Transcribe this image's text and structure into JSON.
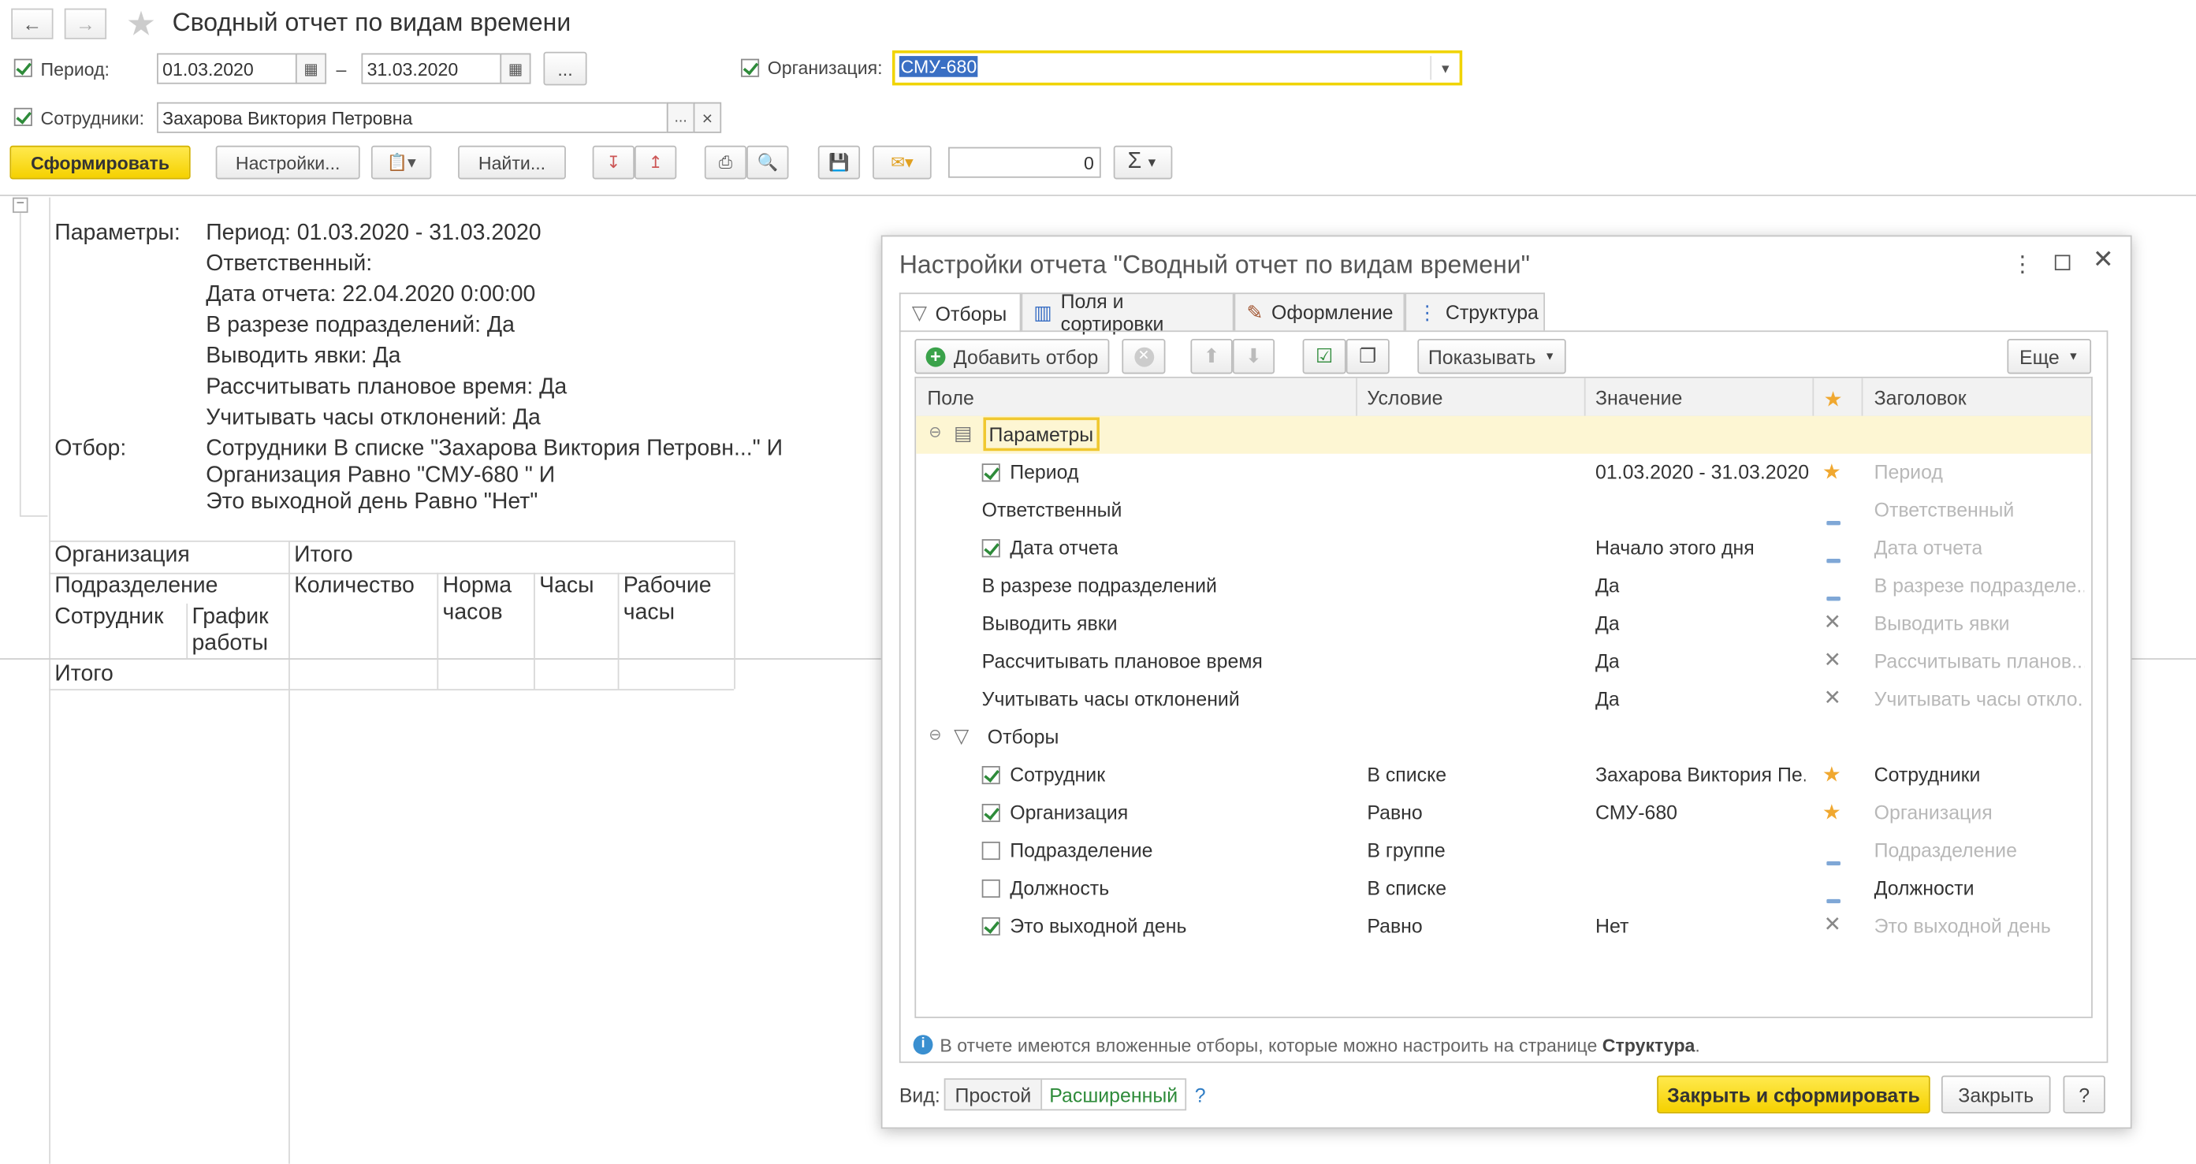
{
  "window": {
    "title": "Сводный отчет по видам времени"
  },
  "form": {
    "period_label": "Период:",
    "period_from": "01.03.2020",
    "period_dash": "–",
    "period_to": "31.03.2020",
    "ellipsis": "...",
    "org_label": "Организация:",
    "org_value": "СМУ-680",
    "employees_label": "Сотрудники:",
    "employees_value": "Захарова Виктория Петровна",
    "clear": "×"
  },
  "toolbar": {
    "generate": "Сформировать",
    "settings": "Настройки...",
    "find": "Найти...",
    "sum_value": "0",
    "sigma": "Σ"
  },
  "report": {
    "params_label": "Параметры:",
    "params": [
      "Период: 01.03.2020 - 31.03.2020",
      "Ответственный:",
      "Дата отчета: 22.04.2020 0:00:00",
      "В разрезе подразделений: Да",
      "Выводить явки: Да",
      "Рассчитывать плановое время: Да",
      "Учитывать часы отклонений: Да"
    ],
    "filter_label": "Отбор:",
    "filters": [
      "Сотрудники В списке \"Захарова Виктория Петровн...\" И",
      "Организация Равно \"СМУ-680 \" И",
      "Это выходной день Равно \"Нет\""
    ],
    "table": {
      "org": "Организация",
      "total_head": "Итого",
      "dept": "Подразделение",
      "qty": "Количество",
      "norm1": "Норма",
      "norm2": "часов",
      "hours": "Часы",
      "work1": "Рабочие",
      "work2": "часы",
      "emp": "Сотрудник",
      "sched1": "График",
      "sched2": "работы",
      "total_row": "Итого"
    }
  },
  "dialog": {
    "title": "Настройки отчета \"Сводный отчет по видам времени\"",
    "tabs": [
      "Отборы",
      "Поля и сортировки",
      "Оформление",
      "Структура"
    ],
    "add_filter": "Добавить отбор",
    "show": "Показывать",
    "more": "Еще",
    "columns": [
      "Поле",
      "Условие",
      "Значение",
      "Заголовок"
    ],
    "groups": {
      "params": "Параметры",
      "filters": "Отборы"
    },
    "param_rows": [
      {
        "field": "Период",
        "value": "01.03.2020 - 31.03.2020",
        "title": "Период"
      },
      {
        "field": "Ответственный",
        "value": "",
        "title": "Ответственный"
      },
      {
        "field": "Дата отчета",
        "value": "Начало этого дня",
        "title": "Дата отчета"
      },
      {
        "field": "В разрезе подразделений",
        "value": "Да",
        "title": "В разрезе подразделе..."
      },
      {
        "field": "Выводить явки",
        "value": "Да",
        "title": "Выводить явки"
      },
      {
        "field": "Рассчитывать плановое время",
        "value": "Да",
        "title": "Рассчитывать планов..."
      },
      {
        "field": "Учитывать часы отклонений",
        "value": "Да",
        "title": "Учитывать часы откло..."
      }
    ],
    "filter_rows": [
      {
        "field": "Сотрудник",
        "cond": "В списке",
        "value": "Захарова Виктория Пе...",
        "title": "Сотрудники"
      },
      {
        "field": "Организация",
        "cond": "Равно",
        "value": "СМУ-680",
        "title": "Организация"
      },
      {
        "field": "Подразделение",
        "cond": "В группе",
        "value": "",
        "title": "Подразделение"
      },
      {
        "field": "Должность",
        "cond": "В списке",
        "value": "",
        "title": "Должности"
      },
      {
        "field": "Это выходной день",
        "cond": "Равно",
        "value": "Нет",
        "title": "Это выходной день"
      }
    ],
    "info_text": "В отчете имеются вложенные отборы, которые можно настроить на странице",
    "info_link": "Структура",
    "info_end": ".",
    "view_label": "Вид:",
    "view_simple": "Простой",
    "view_advanced": "Расширенный",
    "help_q": "?",
    "close_generate": "Закрыть и сформировать",
    "close": "Закрыть"
  },
  "colors": {
    "accent_yellow": "#f5d100",
    "check_green": "#2e8b3a",
    "star_orange": "#f0a830"
  }
}
